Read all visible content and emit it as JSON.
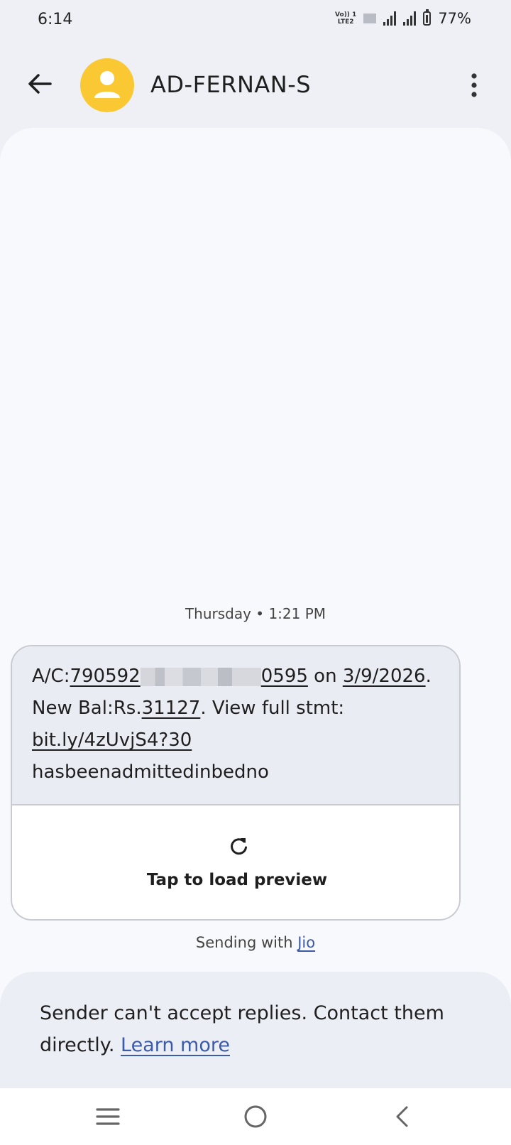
{
  "status": {
    "time": "6:14",
    "volte_top": "Vo)) 1",
    "volte_bottom": "LTE2",
    "battery": "77%"
  },
  "header": {
    "contact_name": "AD-FERNAN-S",
    "avatar_color": "#f9c832"
  },
  "conversation": {
    "timestamp": "Thursday • 1:21 PM",
    "message": {
      "acct_prefix": "A/C:",
      "acct_start": "790592",
      "acct_end": "0595",
      "on": " on",
      "date": "3/9/2026",
      "bal_prefix": ". New Bal:Rs.",
      "balance": "31127",
      "view_text": ". View full stmt: ",
      "link": "bit.ly/4zUvjS4?30",
      "tail": "hasbeenadmittedinbedno"
    },
    "preview_label": "Tap to load preview",
    "sending_prefix": "Sending with ",
    "carrier": "Jio"
  },
  "reply_banner": {
    "text": "Sender can't accept replies. Contact them directly. ",
    "link": "Learn more"
  },
  "icons": {
    "back": "arrow-left-icon",
    "more": "more-vertical-icon",
    "refresh": "refresh-icon",
    "nav_recents": "menu-icon",
    "nav_home": "home-circle-icon",
    "nav_back": "chevron-left-icon"
  },
  "colors": {
    "link": "#3b5ba8",
    "background": "#eef0f6"
  }
}
